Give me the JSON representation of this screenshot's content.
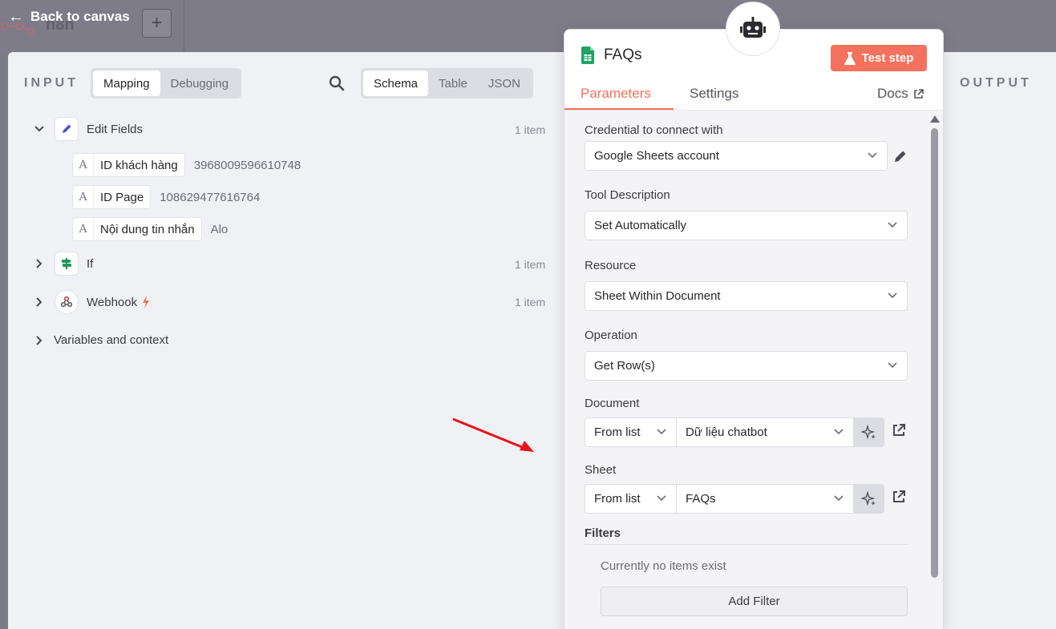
{
  "topbar": {
    "back_label": "Back to canvas",
    "logo_text": "n8n",
    "add_label": "+"
  },
  "input_panel": {
    "title": "INPUT",
    "mode_tabs": [
      {
        "label": "Mapping",
        "active": true
      },
      {
        "label": "Debugging",
        "active": false
      }
    ],
    "view_tabs": [
      {
        "label": "Schema",
        "active": true
      },
      {
        "label": "Table",
        "active": false
      },
      {
        "label": "JSON",
        "active": false
      }
    ],
    "nodes": [
      {
        "name": "Edit Fields",
        "count": "1 item",
        "expanded": true,
        "icon": "pencil-icon",
        "fields": [
          {
            "type": "A",
            "name": "ID khách hàng",
            "value": "3968009596610748"
          },
          {
            "type": "A",
            "name": "ID Page",
            "value": "108629477616764"
          },
          {
            "type": "A",
            "name": "Nội dung tin nhắn",
            "value": "Alo"
          }
        ]
      },
      {
        "name": "If",
        "count": "1 item",
        "expanded": false,
        "icon": "signpost-icon"
      },
      {
        "name": "Webhook",
        "count": "1 item",
        "expanded": false,
        "icon": "webhook-icon"
      }
    ],
    "variables_label": "Variables and context"
  },
  "output_panel": {
    "title": "OUTPUT"
  },
  "node_panel": {
    "title": "FAQs",
    "test_button": "Test step",
    "tabs": [
      {
        "label": "Parameters",
        "active": true
      },
      {
        "label": "Settings",
        "active": false
      }
    ],
    "docs_label": "Docs",
    "params": {
      "credential": {
        "label": "Credential to connect with",
        "value": "Google Sheets account"
      },
      "tool_description": {
        "label": "Tool Description",
        "value": "Set Automatically"
      },
      "resource": {
        "label": "Resource",
        "value": "Sheet Within Document"
      },
      "operation": {
        "label": "Operation",
        "value": "Get Row(s)"
      },
      "document": {
        "label": "Document",
        "mode": "From list",
        "value": "Dữ liệu chatbot"
      },
      "sheet": {
        "label": "Sheet",
        "mode": "From list",
        "value": "FAQs"
      },
      "filters": {
        "label": "Filters",
        "empty_text": "Currently no items exist",
        "add_label": "Add Filter"
      }
    }
  },
  "colors": {
    "accent": "#f4725d",
    "backdrop": "#7e7c88",
    "sheets_green": "#1fa463",
    "arrow_red": "#e8131b"
  }
}
